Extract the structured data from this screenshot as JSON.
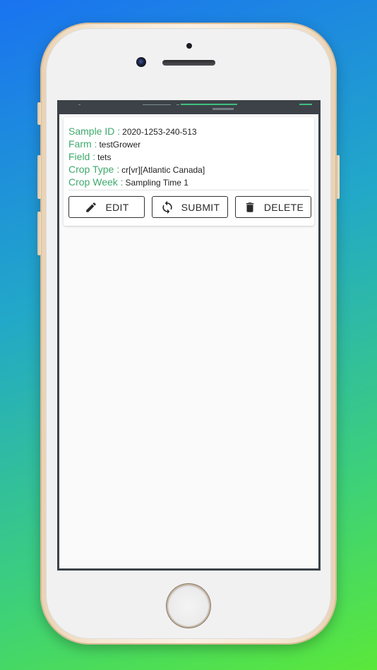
{
  "sample": {
    "sample_id_label": "Sample ID :",
    "sample_id_value": "2020-1253-240-513",
    "farm_label": "Farm :",
    "farm_value": "testGrower",
    "field_label": "Field :",
    "field_value": "tets",
    "crop_type_label": "Crop Type :",
    "crop_type_value": "cr[vr][Atlantic Canada]",
    "crop_week_label": "Crop Week :",
    "crop_week_value": "Sampling Time 1"
  },
  "actions": {
    "edit_label": "EDIT",
    "submit_label": "SUBMIT",
    "delete_label": "DELETE",
    "edit_icon": "pencil-icon",
    "submit_icon": "sync-icon",
    "delete_icon": "trash-icon"
  },
  "colors": {
    "label_green": "#3fa96d",
    "status_bar": "#3c4247",
    "status_accent": "#3fbf7f"
  }
}
